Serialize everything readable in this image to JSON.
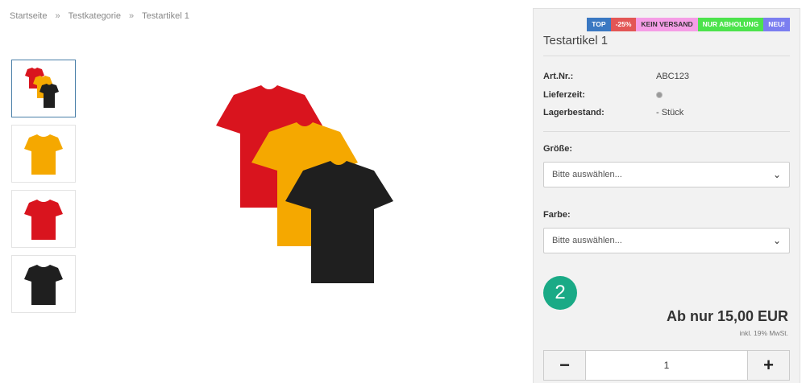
{
  "breadcrumb": {
    "items": [
      "Startseite",
      "Testkategorie",
      "Testartikel 1"
    ],
    "separator": "»"
  },
  "gallery": {
    "thumbnails": [
      {
        "label": "tshirt-group",
        "colors": [
          "#d9141e",
          "#f5a800",
          "#1f1f1f"
        ]
      },
      {
        "label": "tshirt-yellow",
        "colors": [
          "#f5a800"
        ]
      },
      {
        "label": "tshirt-red",
        "colors": [
          "#d9141e"
        ]
      },
      {
        "label": "tshirt-black",
        "colors": [
          "#1f1f1f"
        ]
      }
    ]
  },
  "product": {
    "badges": [
      "TOP",
      "-25%",
      "KEIN VERSAND",
      "NUR ABHOLUNG",
      "NEU!"
    ],
    "title": "Testartikel 1",
    "specs": {
      "art_nr_label": "Art.Nr.:",
      "art_nr_value": "ABC123",
      "delivery_label": "Lieferzeit:",
      "stock_label": "Lagerbestand:",
      "stock_value": "- Stück"
    },
    "size_label": "Größe:",
    "size_placeholder": "Bitte auswählen...",
    "color_label": "Farbe:",
    "color_placeholder": "Bitte auswählen...",
    "step_number": "2",
    "price": "Ab nur 15,00 EUR",
    "tax_note": "inkl. 19% MwSt.",
    "quantity": "1",
    "minus_label": "−",
    "plus_label": "+"
  },
  "colors": {
    "accent_green": "#1aaa86",
    "panel_bg": "#f2f2f2"
  }
}
